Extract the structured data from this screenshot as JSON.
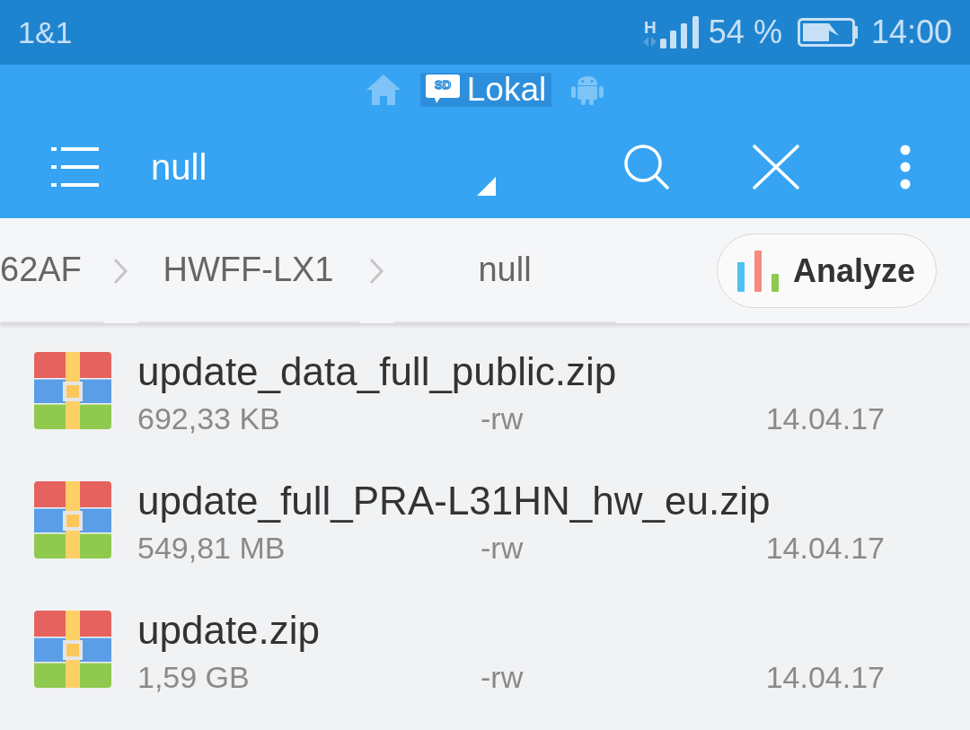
{
  "status_bar": {
    "carrier": "1&1",
    "network_type": "H",
    "battery": "54 %",
    "time": "14:00"
  },
  "locations": [
    {
      "kind": "home",
      "selected": false
    },
    {
      "kind": "sd",
      "icon_label": "SD",
      "label": "Lokal",
      "selected": true
    },
    {
      "kind": "android",
      "selected": false
    }
  ],
  "toolbar": {
    "title": "null"
  },
  "breadcrumbs": [
    "62AF",
    "HWFF-LX1",
    "null"
  ],
  "analyze_button": {
    "label": "Analyze"
  },
  "files": [
    {
      "name": "update_data_full_public.zip",
      "size": "692,33 KB",
      "permissions": "-rw",
      "date": "14.04.17"
    },
    {
      "name": "update_full_PRA-L31HN_hw_eu.zip",
      "size": "549,81 MB",
      "permissions": "-rw",
      "date": "14.04.17"
    },
    {
      "name": "update.zip",
      "size": "1,59 GB",
      "permissions": "-rw",
      "date": "14.04.17"
    }
  ]
}
